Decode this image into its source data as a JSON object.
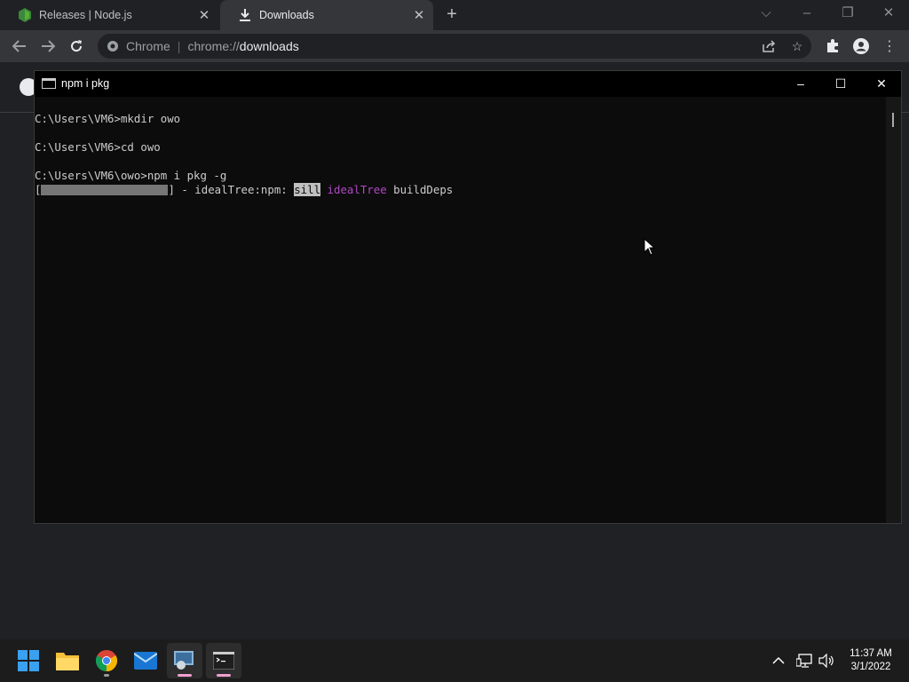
{
  "browser": {
    "tabs": [
      {
        "label": "Releases | Node.js",
        "active": false
      },
      {
        "label": "Downloads",
        "active": true
      }
    ],
    "omnibox": {
      "site": "Chrome",
      "scheme": "chrome://",
      "path": "downloads"
    }
  },
  "cmd_window": {
    "title": "npm i pkg",
    "lines": [
      "C:\\Users\\VM6>mkdir owo",
      "C:\\Users\\VM6>cd owo",
      "C:\\Users\\VM6\\owo>npm i pkg -g"
    ],
    "progress_line": {
      "open_bracket": "[",
      "close_bracket": "] - idealTree:npm: ",
      "level": "sill",
      "stage": "idealTree",
      "message": " buildDeps"
    }
  },
  "taskbar": {
    "time": "11:37 AM",
    "date": "3/1/2022"
  },
  "colors": {
    "accent_magenta": "#b148c6",
    "console_bg": "#0c0c0c",
    "console_text": "#cccccc"
  }
}
